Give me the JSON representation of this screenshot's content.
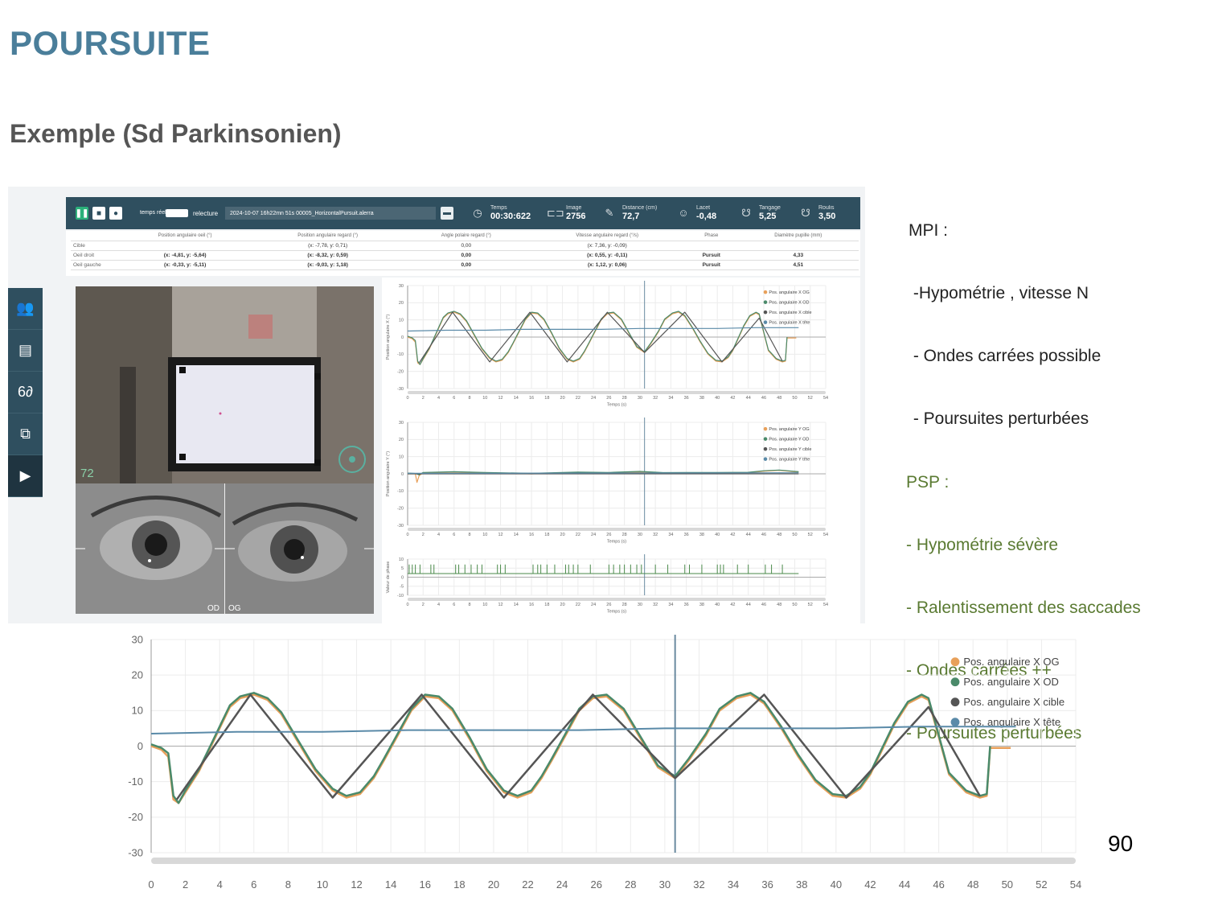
{
  "slide": {
    "title": "POURSUITE",
    "subtitle": "Exemple (Sd Parkinsonien)",
    "page_number": "90",
    "mpi_notes": [
      "MPI :",
      " -Hypométrie , vitesse N",
      " - Ondes carrées possible",
      " - Poursuites perturbées"
    ],
    "psp_notes": [
      "PSP :",
      "- Hypométrie sévère",
      "- Ralentissement des saccades",
      "- Ondes carrées ++",
      "- Poursuites perturbées"
    ],
    "colors": {
      "title": "#4a7e9a",
      "psp": "#5a7a32",
      "app_bar": "#2f4f5f"
    }
  },
  "app": {
    "controls": [
      {
        "icon": "pause-icon",
        "glyph": "❚❚"
      },
      {
        "icon": "stop-icon",
        "glyph": "■"
      },
      {
        "icon": "record-icon",
        "glyph": "●"
      }
    ],
    "mode_label": "temps réel",
    "relecture_label": "relecture",
    "file_name": "2024-10-07 16h22mn 51s 00005_HorizontalPursuit.alerra",
    "stats": [
      {
        "icon": "clock-icon",
        "label": "Temps",
        "value": "00:30:622"
      },
      {
        "icon": "image-icon",
        "label": "Image",
        "value": "2756"
      },
      {
        "icon": "ruler-icon",
        "label": "Distance (cm)",
        "value": "72,7"
      },
      {
        "icon": "head-yaw-icon",
        "label": "Lacet",
        "value": "-0,48"
      },
      {
        "icon": "head-pitch-icon",
        "label": "Tangage",
        "value": "5,25"
      },
      {
        "icon": "head-roll-icon",
        "label": "Roulis",
        "value": "3,50"
      }
    ],
    "sidebar": [
      {
        "icon": "patients-icon",
        "glyph": "👥"
      },
      {
        "icon": "id-card-icon",
        "glyph": "▤"
      },
      {
        "icon": "glasses-icon",
        "glyph": "6∂"
      },
      {
        "icon": "screen-target-icon",
        "glyph": "⧉"
      },
      {
        "icon": "play-icon",
        "glyph": "▶"
      }
    ],
    "table": {
      "headers": [
        "",
        "Position angulaire oeil (°)",
        "Position angulaire regard (°)",
        "Angle polaire regard (°)",
        "Vitesse angulaire regard (°/s)",
        "Phase",
        "Diamètre pupille (mm)"
      ],
      "rows": [
        [
          "Cible",
          "",
          "(x: -7,78, y: 0,71)",
          "0,00",
          "(x: 7,36, y: -0,09)",
          "",
          ""
        ],
        [
          "Oeil droit",
          "(x: -4,81, y: -5,64)",
          "(x: -8,32, y: 0,59)",
          "0,00",
          "(x: 0,55, y: -0,11)",
          "Pursuit",
          "4,33"
        ],
        [
          "Oeil gauche",
          "(x: -0,33, y: -5,11)",
          "(x: -9,03, y: 1,18)",
          "0,00",
          "(x: 1,12, y: 0,06)",
          "Pursuit",
          "4,51"
        ]
      ]
    },
    "video_distance": "72",
    "eye_labels": {
      "right": "OD",
      "left": "OG"
    }
  },
  "chart_data": [
    {
      "type": "line",
      "id": "small-x",
      "ylabel": "Position angulaire X (°)",
      "xlabel": "Temps (s)",
      "xlim": [
        0,
        54
      ],
      "ylim": [
        -30,
        30
      ],
      "yticks": [
        30,
        20,
        10,
        0,
        -10,
        -20,
        -30
      ],
      "xticks": [
        0,
        2,
        4,
        6,
        8,
        10,
        12,
        14,
        16,
        18,
        20,
        22,
        24,
        26,
        28,
        30,
        32,
        34,
        36,
        38,
        40,
        42,
        44,
        46,
        48,
        50,
        52,
        54
      ],
      "cursor_x": 30.6,
      "legend": [
        "Pos. angulaire X OG",
        "Pos. angulaire X OD",
        "Pos. angulaire X cible",
        "Pos. angulaire X tête"
      ],
      "legend_colors": [
        "#e8a05a",
        "#4a8a6a",
        "#555555",
        "#5a8aa8"
      ],
      "legend_position": "top-right",
      "grid": true
    },
    {
      "type": "line",
      "id": "small-y",
      "ylabel": "Position angulaire Y (°)",
      "xlabel": "Temps (s)",
      "xlim": [
        0,
        54
      ],
      "ylim": [
        -30,
        30
      ],
      "yticks": [
        30,
        20,
        10,
        0,
        -10,
        -20,
        -30
      ],
      "cursor_x": 30.6,
      "legend": [
        "Pos. angulaire Y OG",
        "Pos. angulaire Y OD",
        "Pos. angulaire Y cible",
        "Pos. angulaire Y tête"
      ],
      "legend_colors": [
        "#e8a05a",
        "#4a8a6a",
        "#555555",
        "#5a8aa8"
      ],
      "legend_position": "top-right",
      "grid": true
    },
    {
      "type": "bar",
      "id": "small-phase",
      "ylabel": "Valeur de phase",
      "xlabel": "Temps (s)",
      "xlim": [
        0,
        54
      ],
      "ylim": [
        -10,
        10
      ],
      "yticks": [
        10,
        5,
        0,
        -5,
        -10
      ],
      "cursor_x": 30.6,
      "events": [
        0.2,
        0.6,
        1.0,
        1.6,
        3.0,
        3.4,
        6.2,
        6.6,
        7.4,
        8.2,
        9.0,
        9.6,
        11.6,
        12.0,
        12.6,
        16.2,
        16.8,
        17.2,
        18.0,
        19.0,
        20.4,
        20.8,
        21.4,
        22.0,
        23.6,
        26.0,
        26.6,
        27.4,
        28.0,
        28.8,
        29.6,
        30.2,
        32.0,
        33.6,
        35.8,
        36.4,
        38.0,
        40.0,
        40.4,
        40.8,
        42.6,
        44.0,
        46.2,
        47.0,
        48.4
      ]
    },
    {
      "type": "line",
      "id": "big-x",
      "xlim": [
        0,
        54
      ],
      "ylim": [
        -30,
        30
      ],
      "yticks": [
        30,
        20,
        10,
        0,
        -10,
        -20,
        -30
      ],
      "xticks": [
        0,
        2,
        4,
        6,
        8,
        10,
        12,
        14,
        16,
        18,
        20,
        22,
        24,
        26,
        28,
        30,
        32,
        34,
        36,
        38,
        40,
        42,
        44,
        46,
        48,
        50,
        52,
        54
      ],
      "cursor_x": 30.6,
      "legend": [
        "Pos. angulaire X OG",
        "Pos. angulaire X OD",
        "Pos. angulaire X cible",
        "Pos. angulaire X tête"
      ],
      "legend_colors": [
        "#e8a05a",
        "#4a8a6a",
        "#555555",
        "#5a8aa8"
      ],
      "legend_position": "top-right",
      "grid": true,
      "series": [
        {
          "name": "Pos. angulaire X OG",
          "x": [
            0,
            0.6,
            1.0,
            1.3,
            1.6,
            2.0,
            2.8,
            3.6,
            4.2,
            4.6,
            5.2,
            6.0,
            6.8,
            7.6,
            8.6,
            9.6,
            10.6,
            11.4,
            12.2,
            13.0,
            13.6,
            14.4,
            15.2,
            16.0,
            16.8,
            17.6,
            18.6,
            19.6,
            20.6,
            21.4,
            22.2,
            22.8,
            23.4,
            24.2,
            25.0,
            25.8,
            26.6,
            27.6,
            28.6,
            29.6,
            30.6,
            31.4,
            32.4,
            33.2,
            34.2,
            35.0,
            35.8,
            36.8,
            37.8,
            38.8,
            39.8,
            40.6,
            41.4,
            42.0,
            42.6,
            43.4,
            44.2,
            45.0,
            45.4,
            45.8,
            46.6,
            47.6,
            48.4,
            48.8,
            49.0,
            50.2
          ],
          "y": [
            0,
            -1,
            -3,
            -15,
            -16,
            -13,
            -7,
            1,
            7,
            11,
            13.5,
            14.5,
            13,
            9,
            1,
            -7,
            -12.5,
            -14.5,
            -13.5,
            -9,
            -4,
            3,
            10,
            14,
            13.5,
            10,
            2,
            -7,
            -13,
            -14.5,
            -13,
            -9,
            -4,
            3,
            10,
            13.5,
            14,
            10,
            2,
            -6,
            -9,
            -4,
            3,
            10,
            13.5,
            14.5,
            12,
            5,
            -3,
            -10,
            -14,
            -14.5,
            -12,
            -8,
            -2,
            6,
            12,
            14,
            13,
            6,
            -8,
            -13,
            -14.5,
            -14,
            -0.5,
            -0.5
          ]
        },
        {
          "name": "Pos. angulaire X OD",
          "x": [
            0,
            0.6,
            1.0,
            1.3,
            1.6,
            2.0,
            2.8,
            3.6,
            4.2,
            4.6,
            5.2,
            6.0,
            6.8,
            7.6,
            8.6,
            9.6,
            10.6,
            11.4,
            12.2,
            13.0,
            13.6,
            14.4,
            15.2,
            16.0,
            16.8,
            17.6,
            18.6,
            19.6,
            20.6,
            21.4,
            22.2,
            22.8,
            23.4,
            24.2,
            25.0,
            25.8,
            26.6,
            27.6,
            28.6,
            29.6,
            30.6,
            31.4,
            32.4,
            33.2,
            34.2,
            35.0,
            35.8,
            36.8,
            37.8,
            38.8,
            39.8,
            40.6,
            41.4,
            42.0,
            42.6,
            43.4,
            44.2,
            45.0,
            45.4,
            45.8,
            46.6,
            47.6,
            48.4,
            48.8,
            49.0
          ],
          "y": [
            0.5,
            -0.5,
            -2,
            -14,
            -16,
            -12.5,
            -6.5,
            1.5,
            7.5,
            11.5,
            14,
            15,
            13.5,
            9.5,
            1.5,
            -6.5,
            -12,
            -14,
            -13,
            -8.5,
            -3.5,
            3.5,
            10.5,
            14.5,
            14,
            10.5,
            2.5,
            -6.5,
            -12.5,
            -14,
            -12.5,
            -8.5,
            -3.5,
            3.5,
            10.5,
            14,
            14.5,
            10.5,
            2.5,
            -5.5,
            -8.5,
            -3.5,
            3.5,
            10.5,
            14,
            15,
            12.5,
            5.5,
            -2.5,
            -9.5,
            -13.5,
            -14,
            -11.5,
            -7.5,
            -1.5,
            6.5,
            12.5,
            14.5,
            13.5,
            6.5,
            -7.5,
            -12.5,
            -14,
            -13.5,
            0
          ]
        },
        {
          "name": "Pos. angulaire X cible",
          "x": [
            1.5,
            5.8,
            10.6,
            15.8,
            20.6,
            25.8,
            30.6,
            35.8,
            40.6,
            45.4,
            48.4
          ],
          "y": [
            -15,
            14.5,
            -14.5,
            14.5,
            -14.5,
            14.5,
            -9,
            14.5,
            -14.5,
            11,
            -14
          ]
        },
        {
          "name": "Pos. angulaire X tête",
          "x": [
            0,
            5,
            10,
            15,
            20,
            25,
            30,
            35,
            40,
            45,
            50.5
          ],
          "y": [
            3.5,
            4,
            4,
            4.5,
            4.5,
            4.5,
            5,
            5,
            5,
            5.5,
            5.5
          ]
        }
      ]
    }
  ]
}
